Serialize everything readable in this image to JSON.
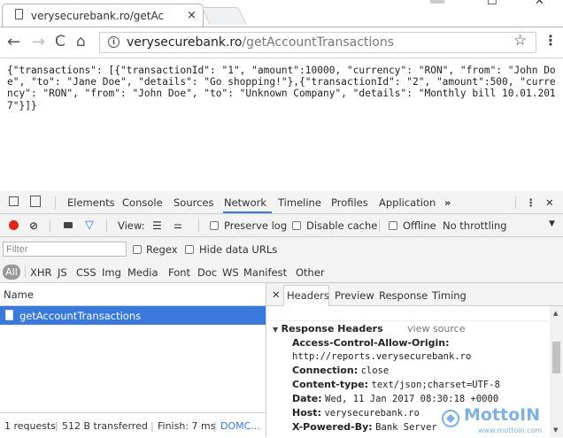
{
  "browser": {
    "tab_title": "verysecurebank.ro/getAc",
    "tab_close": "×",
    "window_controls": {
      "minimize": "—",
      "maximize": "☐",
      "close": "✕"
    },
    "url_host": "verysecurebank.ro",
    "url_path": "/getAccountTransactions"
  },
  "page": {
    "json_text": "{\"transactions\": [{\"transactionId\": \"1\", \"amount\":10000, \"currency\": \"RON\", \"from\": \"John Doe\", \"to\": \"Jane Doe\", \"details\": \"Go shopping!\"},{\"transactionId\": \"2\", \"amount\":500, \"currency\": \"RON\", \"from\": \"John Doe\", \"to\": \"Unknown Company\", \"details\": \"Monthly bill 10.01.2017\"}]}"
  },
  "devtools": {
    "tabs": [
      "Elements",
      "Console",
      "Sources",
      "Network",
      "Timeline",
      "Profiles",
      "Application"
    ],
    "active_tab": "Network",
    "more_tabs": "»",
    "close": "✕",
    "toolbar": {
      "view_label": "View:",
      "preserve_log": "Preserve log",
      "disable_cache": "Disable cache",
      "offline": "Offline",
      "throttling": "No throttling"
    },
    "filter_placeholder": "Filter",
    "regex": "Regex",
    "hide_data_urls": "Hide data URLs",
    "types": [
      "All",
      "XHR",
      "JS",
      "CSS",
      "Img",
      "Media",
      "Font",
      "Doc",
      "WS",
      "Manifest",
      "Other"
    ],
    "name_header": "Name",
    "requests": [
      {
        "name": "getAccountTransactions"
      }
    ],
    "status": {
      "requests": "1 requests",
      "transferred": "512 B transferred",
      "finish": "Finish: 7 ms",
      "domc": "DOMC..."
    },
    "detail_close": "✕",
    "detail_tabs": [
      "Headers",
      "Preview",
      "Response",
      "Timing"
    ],
    "detail_active_tab": "Headers",
    "response_headers_title": "Response Headers",
    "view_source": "view source",
    "response_headers": [
      {
        "key": "Access-Control-Allow-Origin:",
        "value": "http://reports.verysecurebank.ro"
      },
      {
        "key": "Connection:",
        "value": "close"
      },
      {
        "key": "Content-type:",
        "value": "text/json;charset=UTF-8"
      },
      {
        "key": "Date:",
        "value": "Wed, 11 Jan 2017 08:30:18 +0000"
      },
      {
        "key": "Host:",
        "value": "verysecurebank.ro"
      },
      {
        "key": "X-Powered-By:",
        "value": "Bank Server"
      }
    ]
  },
  "watermark": {
    "brand": "MottoIN",
    "url": "www.mottoin.com"
  },
  "colors": {
    "accent": "#3879d9",
    "record": "#e0251b",
    "filter_icon": "#3879d9"
  }
}
